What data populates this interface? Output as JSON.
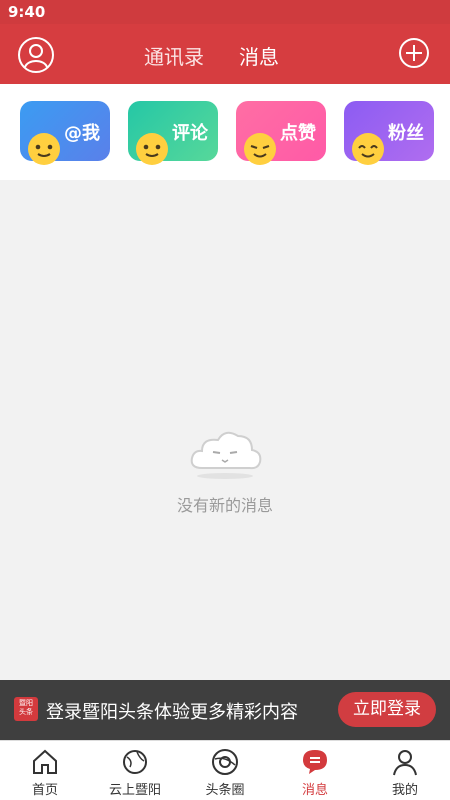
{
  "status_bar": {
    "time": "9:40"
  },
  "header": {
    "tabs": [
      {
        "label": "通讯录"
      },
      {
        "label": "消息"
      }
    ],
    "active_tab": 1
  },
  "shortcuts": [
    {
      "label": "@我"
    },
    {
      "label": "评论"
    },
    {
      "label": "点赞"
    },
    {
      "label": "粉丝"
    }
  ],
  "empty_state": {
    "message": "没有新的消息"
  },
  "login_prompt": {
    "logo_text": "暨阳头条",
    "text": "登录暨阳头条体验更多精彩内容",
    "button": "立即登录"
  },
  "bottom_nav": [
    {
      "label": "首页",
      "icon": "home-icon"
    },
    {
      "label": "云上暨阳",
      "icon": "globe-icon"
    },
    {
      "label": "头条圈",
      "icon": "circle-icon"
    },
    {
      "label": "消息",
      "icon": "message-icon",
      "active": true
    },
    {
      "label": "我的",
      "icon": "user-icon"
    }
  ],
  "colors": {
    "brand": "#d63d40",
    "muted_text": "#9a9a9a"
  }
}
